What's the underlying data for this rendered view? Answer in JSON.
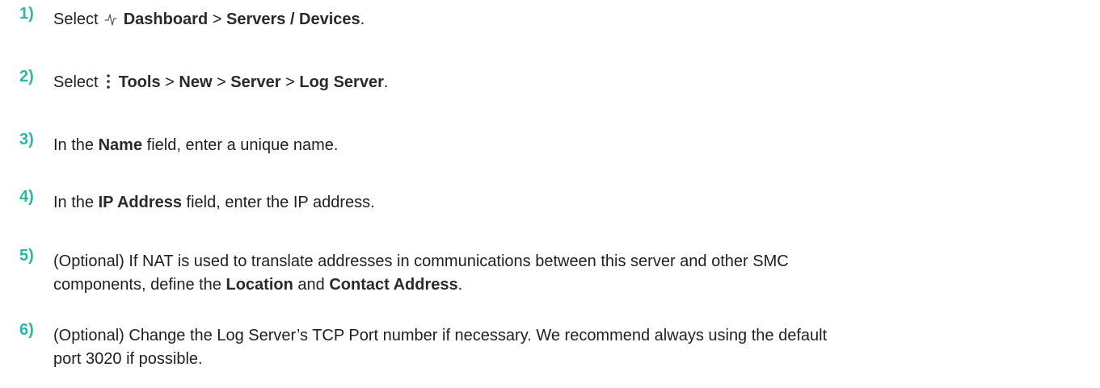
{
  "steps": [
    {
      "number": "1)",
      "parts": [
        "Select ",
        "Dashboard",
        " > ",
        "Servers / Devices",
        "."
      ]
    },
    {
      "number": "2)",
      "parts": [
        "Select ",
        "Tools",
        " > ",
        "New",
        " > ",
        "Server",
        " > ",
        "Log Server",
        "."
      ]
    },
    {
      "number": "3)",
      "parts": [
        "In the ",
        "Name",
        " field, enter a unique name."
      ]
    },
    {
      "number": "4)",
      "parts": [
        "In the ",
        "IP Address",
        " field, enter the IP address."
      ]
    },
    {
      "number": "5)",
      "parts": [
        "(Optional) If NAT is used to translate addresses in communications between this server and other SMC",
        "components, define the ",
        "Location",
        " and ",
        "Contact Address",
        "."
      ]
    },
    {
      "number": "6)",
      "parts": [
        "(Optional) Change the Log Server’s TCP Port number if necessary. We recommend always using the default",
        "port 3020 if possible."
      ]
    }
  ],
  "icons": {
    "dashboard": "activity-pulse-icon",
    "tools": "vertical-ellipsis-icon"
  },
  "colors": {
    "step_number": "#2bb7a3",
    "text": "#1f1f1f"
  }
}
